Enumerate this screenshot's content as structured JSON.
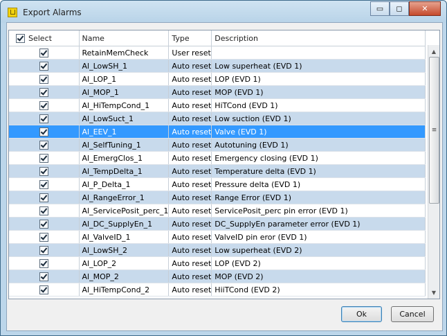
{
  "window": {
    "title": "Export Alarms",
    "minimize_glyph": "▭",
    "maximize_glyph": "◻",
    "close_glyph": "✕"
  },
  "table": {
    "headers": {
      "select": "Select",
      "name": "Name",
      "type": "Type",
      "description": "Description"
    },
    "rows": [
      {
        "name": "RetainMemCheck",
        "type": "User reset",
        "description": ""
      },
      {
        "name": "Al_LowSH_1",
        "type": "Auto reset",
        "description": "Low superheat (EVD 1)"
      },
      {
        "name": "Al_LOP_1",
        "type": "Auto reset",
        "description": "LOP (EVD 1)"
      },
      {
        "name": "Al_MOP_1",
        "type": "Auto reset",
        "description": "MOP (EVD 1)"
      },
      {
        "name": "Al_HiTempCond_1",
        "type": "Auto reset",
        "description": "HiTCond (EVD 1)"
      },
      {
        "name": "Al_LowSuct_1",
        "type": "Auto reset",
        "description": "Low suction (EVD 1)"
      },
      {
        "name": "Al_EEV_1",
        "type": "Auto reset",
        "description": "Valve (EVD 1)"
      },
      {
        "name": "Al_SelfTuning_1",
        "type": "Auto reset",
        "description": "Autotuning (EVD 1)"
      },
      {
        "name": "Al_EmergClos_1",
        "type": "Auto reset",
        "description": "Emergency closing (EVD 1)"
      },
      {
        "name": "Al_TempDelta_1",
        "type": "Auto reset",
        "description": "Temperature delta (EVD 1)"
      },
      {
        "name": "Al_P_Delta_1",
        "type": "Auto reset",
        "description": "Pressure delta (EVD 1)"
      },
      {
        "name": "Al_RangeError_1",
        "type": "Auto reset",
        "description": "Range Error (EVD 1)"
      },
      {
        "name": "Al_ServicePosit_perc_1",
        "type": "Auto reset",
        "description": "ServicePosit_perc pin error (EVD 1)"
      },
      {
        "name": "Al_DC_SupplyEn_1",
        "type": "Auto reset",
        "description": "DC_SupplyEn parameter error (EVD 1)"
      },
      {
        "name": "Al_ValveID_1",
        "type": "Auto reset",
        "description": "ValveID pin eror (EVD 1)"
      },
      {
        "name": "Al_LowSH_2",
        "type": "Auto reset",
        "description": "Low superheat (EVD 2)"
      },
      {
        "name": "Al_LOP_2",
        "type": "Auto reset",
        "description": "LOP (EVD 2)"
      },
      {
        "name": "Al_MOP_2",
        "type": "Auto reset",
        "description": "MOP (EVD 2)"
      },
      {
        "name": "Al_HiTempCond_2",
        "type": "Auto reset",
        "description": "HiiTCond (EVD 2)"
      }
    ]
  },
  "scrollbar": {
    "up_glyph": "▲",
    "down_glyph": "▼",
    "grip_glyph": "≡"
  },
  "buttons": {
    "ok": "Ok",
    "cancel": "Cancel"
  }
}
